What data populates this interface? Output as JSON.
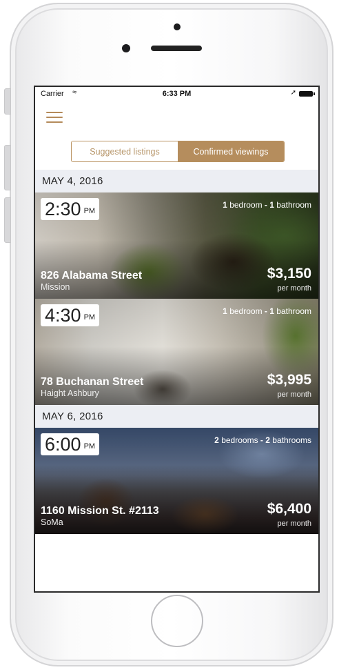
{
  "status_bar": {
    "carrier": "Carrier",
    "wifi_icon": "wifi-icon",
    "time": "6:33 PM",
    "location_icon": "location-arrow-icon",
    "battery_icon": "battery-icon"
  },
  "nav": {
    "menu_icon": "hamburger-menu-icon"
  },
  "tabs": [
    {
      "label": "Suggested listings",
      "active": false
    },
    {
      "label": "Confirmed viewings",
      "active": true
    }
  ],
  "colors": {
    "accent": "#b58d5d",
    "date_header_bg": "#eceef3"
  },
  "sections": [
    {
      "date": "MAY 4, 2016",
      "listings": [
        {
          "time": "2:30",
          "ampm": "PM",
          "beds": "1",
          "beds_label": "bedroom",
          "sep": "-",
          "baths": "1",
          "baths_label": "bathroom",
          "address": "826 Alabama Street",
          "neighborhood": "Mission",
          "price": "$3,150",
          "per": "per month"
        },
        {
          "time": "4:30",
          "ampm": "PM",
          "beds": "1",
          "beds_label": "bedroom",
          "sep": "-",
          "baths": "1",
          "baths_label": "bathroom",
          "address": "78 Buchanan Street",
          "neighborhood": "Haight Ashbury",
          "price": "$3,995",
          "per": "per month"
        }
      ]
    },
    {
      "date": "MAY 6, 2016",
      "listings": [
        {
          "time": "6:00",
          "ampm": "PM",
          "beds": "2",
          "beds_label": "bedrooms",
          "sep": "-",
          "baths": "2",
          "baths_label": "bathrooms",
          "address": "1160 Mission St. #2113",
          "neighborhood": "SoMa",
          "price": "$6,400",
          "per": "per month"
        }
      ]
    }
  ]
}
